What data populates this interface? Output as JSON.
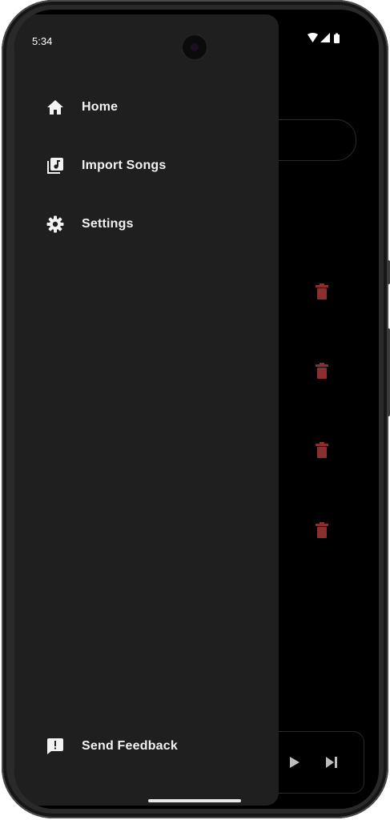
{
  "status_bar": {
    "time": "5:34",
    "icons": [
      "wifi-icon",
      "signal-icon",
      "battery-icon"
    ]
  },
  "drawer": {
    "items": [
      {
        "label": "Home",
        "icon": "home-icon"
      },
      {
        "label": "Import Songs",
        "icon": "library-music-icon"
      },
      {
        "label": "Settings",
        "icon": "gear-icon"
      }
    ],
    "footer": {
      "label": "Send Feedback",
      "icon": "feedback-icon"
    }
  },
  "background": {
    "list_actions": [
      "delete-icon",
      "delete-icon",
      "delete-icon",
      "delete-icon"
    ],
    "player_controls": [
      "play-icon",
      "skip-next-icon"
    ]
  },
  "colors": {
    "drawer_bg": "#1f1f1f",
    "screen_bg": "#000000",
    "text": "#f2f2f2",
    "delete_accent": "#8a2f2f"
  }
}
